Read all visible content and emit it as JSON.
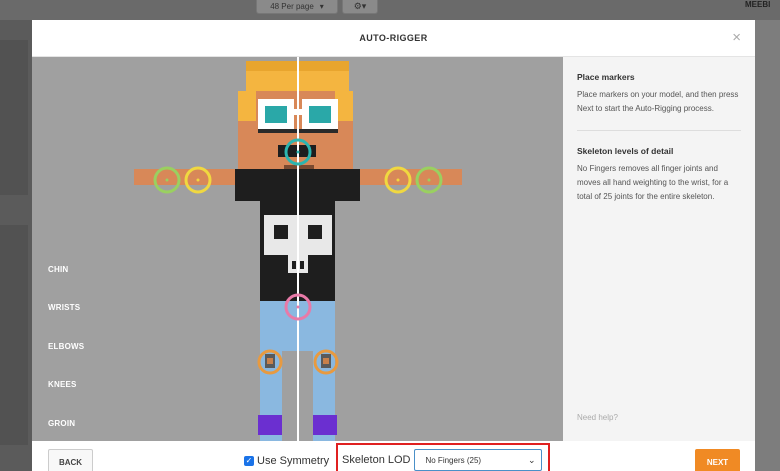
{
  "background": {
    "per_page": "48 Per page",
    "per_page_chevron": "▾",
    "settings_icon": "gear-icon",
    "user": "MEEBI"
  },
  "modal": {
    "title": "AUTO-RIGGER",
    "close": "×"
  },
  "markers": [
    "CHIN",
    "WRISTS",
    "ELBOWS",
    "KNEES",
    "GROIN"
  ],
  "panel": {
    "heading1": "Place markers",
    "text1": "Place markers on your model, and then press Next to start the Auto-Rigging process.",
    "heading2": "Skeleton levels of detail",
    "text2": "No Fingers removes all finger joints and moves all hand weighting to the wrist, for a total of 25 joints for the entire skeleton.",
    "help": "Need help?"
  },
  "footer": {
    "back": "BACK",
    "symmetry_label": "Use Symmetry",
    "symmetry_checked": true,
    "lod_label": "Skeleton LOD",
    "lod_value": "No Fingers (25)",
    "next": "NEXT"
  },
  "colors": {
    "accent": "#f08a24",
    "highlight_border": "#e02020",
    "chin_marker": "#2bb5b0",
    "wrist_marker": "#f0d840",
    "elbow_marker": "#9ad060",
    "groin_marker": "#e87aa8",
    "knee_marker": "#e89a40"
  }
}
